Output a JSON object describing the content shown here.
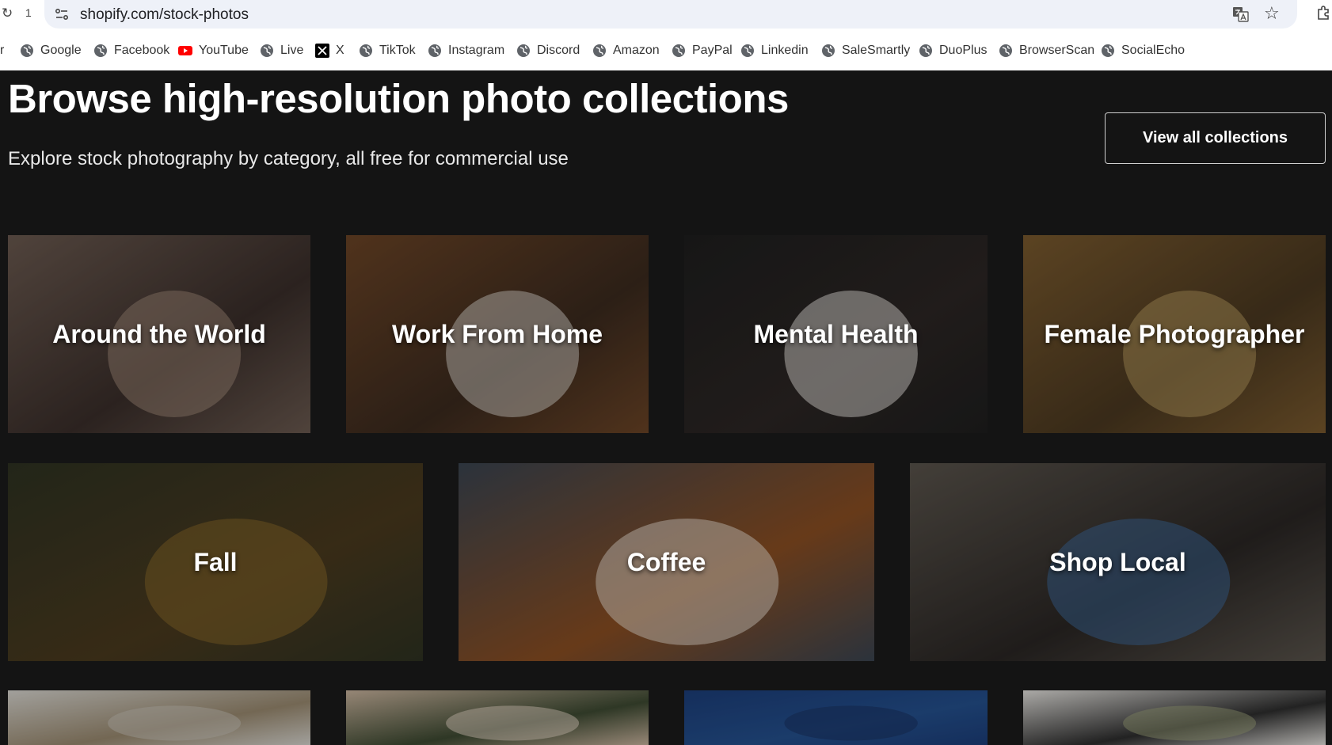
{
  "browser": {
    "tab_count": "1",
    "url": "shopify.com/stock-photos",
    "bookmark_cut": "r",
    "bookmarks": [
      {
        "label": "Google",
        "icon": "globe-icon"
      },
      {
        "label": "Facebook",
        "icon": "globe-icon"
      },
      {
        "label": "YouTube",
        "icon": "youtube-icon"
      },
      {
        "label": "Live",
        "icon": "globe-icon"
      },
      {
        "label": "X",
        "icon": "x-icon"
      },
      {
        "label": "TikTok",
        "icon": "globe-icon"
      },
      {
        "label": "Instagram",
        "icon": "globe-icon"
      },
      {
        "label": "Discord",
        "icon": "globe-icon"
      },
      {
        "label": "Amazon",
        "icon": "globe-icon"
      },
      {
        "label": "PayPal",
        "icon": "globe-icon"
      },
      {
        "label": "Linkedin",
        "icon": "globe-icon"
      },
      {
        "label": "SaleSmartly",
        "icon": "globe-icon"
      },
      {
        "label": "DuoPlus",
        "icon": "globe-icon"
      },
      {
        "label": "BrowserScan",
        "icon": "globe-icon"
      },
      {
        "label": "SocialEcho",
        "icon": "globe-icon"
      }
    ]
  },
  "header": {
    "title": "Browse high-resolution photo collections",
    "subtitle": "Explore stock photography by category, all free for commercial use",
    "view_all_label": "View all collections"
  },
  "collections": [
    {
      "label": "Around the World",
      "palette": [
        "#6b5a50",
        "#3a2e2a",
        "#a08878"
      ]
    },
    {
      "label": "Work From Home",
      "palette": [
        "#6b4426",
        "#3b2a1e",
        "#d8d4cc"
      ]
    },
    {
      "label": "Mental Health",
      "palette": [
        "#1e1e1e",
        "#2c2624",
        "#e9e6e0"
      ]
    },
    {
      "label": "Female Photographer",
      "palette": [
        "#7a5a2e",
        "#4a3820",
        "#b89a5e"
      ]
    },
    {
      "label": "Fall",
      "palette": [
        "#2e3222",
        "#4a3a1e",
        "#8a6a2a"
      ]
    },
    {
      "label": "Coffee",
      "palette": [
        "#3a4450",
        "#8a4e22",
        "#e8ddd0"
      ]
    },
    {
      "label": "Shop Local",
      "palette": [
        "#5a544c",
        "#2a2624",
        "#3e6a9a"
      ]
    },
    {
      "label": "",
      "palette": [
        "#d8d6d0",
        "#9a8a70",
        "#c8c2b8"
      ]
    },
    {
      "label": "",
      "palette": [
        "#c9b49e",
        "#3e4a32",
        "#e2d4c2"
      ]
    },
    {
      "label": "",
      "palette": [
        "#1c3e7a",
        "#24508e",
        "#1a3260"
      ]
    },
    {
      "label": "",
      "palette": [
        "#e4e2de",
        "#2e2e2e",
        "#9aa07a"
      ]
    }
  ]
}
